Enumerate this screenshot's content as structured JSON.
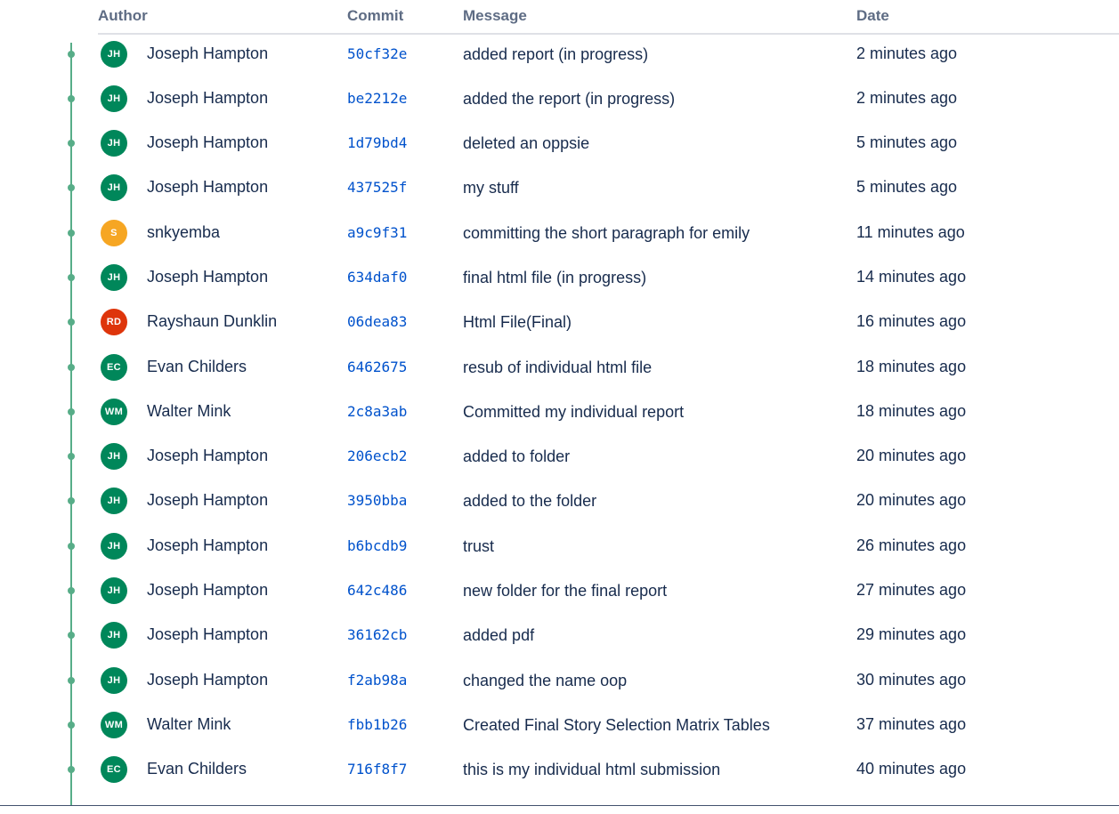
{
  "columns": {
    "author": "Author",
    "commit": "Commit",
    "message": "Message",
    "date": "Date"
  },
  "colors": {
    "graph": "#57ad88",
    "hash_link": "#0052cc",
    "avatar_green": "#00875a",
    "avatar_orange": "#f6a623",
    "avatar_red": "#de350b"
  },
  "commits": [
    {
      "initials": "JH",
      "avatar_color": "#00875a",
      "author": "Joseph Hampton",
      "hash": "50cf32e",
      "message": "added report (in progress)",
      "date": "2 minutes ago"
    },
    {
      "initials": "JH",
      "avatar_color": "#00875a",
      "author": "Joseph Hampton",
      "hash": "be2212e",
      "message": "added the report (in progress)",
      "date": "2 minutes ago"
    },
    {
      "initials": "JH",
      "avatar_color": "#00875a",
      "author": "Joseph Hampton",
      "hash": "1d79bd4",
      "message": "deleted an oppsie",
      "date": "5 minutes ago"
    },
    {
      "initials": "JH",
      "avatar_color": "#00875a",
      "author": "Joseph Hampton",
      "hash": "437525f",
      "message": "my stuff",
      "date": "5 minutes ago"
    },
    {
      "initials": "S",
      "avatar_color": "#f6a623",
      "author": "snkyemba",
      "hash": "a9c9f31",
      "message": "committing the short paragraph for emily",
      "date": "11 minutes ago"
    },
    {
      "initials": "JH",
      "avatar_color": "#00875a",
      "author": "Joseph Hampton",
      "hash": "634daf0",
      "message": "final html file (in progress)",
      "date": "14 minutes ago"
    },
    {
      "initials": "RD",
      "avatar_color": "#de350b",
      "author": "Rayshaun Dunklin",
      "hash": "06dea83",
      "message": "Html File(Final)",
      "date": "16 minutes ago"
    },
    {
      "initials": "EC",
      "avatar_color": "#00875a",
      "author": "Evan Childers",
      "hash": "6462675",
      "message": "resub of individual html file",
      "date": "18 minutes ago"
    },
    {
      "initials": "WM",
      "avatar_color": "#00875a",
      "author": "Walter Mink",
      "hash": "2c8a3ab",
      "message": "Committed my individual report",
      "date": "18 minutes ago"
    },
    {
      "initials": "JH",
      "avatar_color": "#00875a",
      "author": "Joseph Hampton",
      "hash": "206ecb2",
      "message": "added to folder",
      "date": "20 minutes ago"
    },
    {
      "initials": "JH",
      "avatar_color": "#00875a",
      "author": "Joseph Hampton",
      "hash": "3950bba",
      "message": "added to the folder",
      "date": "20 minutes ago"
    },
    {
      "initials": "JH",
      "avatar_color": "#00875a",
      "author": "Joseph Hampton",
      "hash": "b6bcdb9",
      "message": "trust",
      "date": "26 minutes ago"
    },
    {
      "initials": "JH",
      "avatar_color": "#00875a",
      "author": "Joseph Hampton",
      "hash": "642c486",
      "message": "new folder for the final report",
      "date": "27 minutes ago"
    },
    {
      "initials": "JH",
      "avatar_color": "#00875a",
      "author": "Joseph Hampton",
      "hash": "36162cb",
      "message": "added pdf",
      "date": "29 minutes ago"
    },
    {
      "initials": "JH",
      "avatar_color": "#00875a",
      "author": "Joseph Hampton",
      "hash": "f2ab98a",
      "message": "changed the name oop",
      "date": "30 minutes ago"
    },
    {
      "initials": "WM",
      "avatar_color": "#00875a",
      "author": "Walter Mink",
      "hash": "fbb1b26",
      "message": "Created Final Story Selection Matrix Tables",
      "date": "37 minutes ago"
    },
    {
      "initials": "EC",
      "avatar_color": "#00875a",
      "author": "Evan Childers",
      "hash": "716f8f7",
      "message": "this is my individual html submission",
      "date": "40 minutes ago"
    }
  ]
}
